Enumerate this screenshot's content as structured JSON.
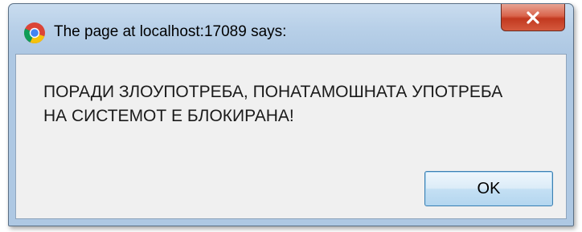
{
  "dialog": {
    "title": "The page at localhost:17089 says:",
    "title_icon": "chrome-icon",
    "close_icon": "close-icon",
    "message_line1": "ПОРАДИ ЗЛОУПОТРЕБА, ПОНАТАМОШНАТА УПОТРЕБА",
    "message_line2": "НА СИСТЕМОТ Е БЛОКИРАНА!",
    "ok_label": "OK"
  },
  "colors": {
    "frame": "#b8d0e8",
    "client_bg": "#f0f0f0",
    "close_button": "#c2391f",
    "ok_border": "#3c7fb1"
  }
}
